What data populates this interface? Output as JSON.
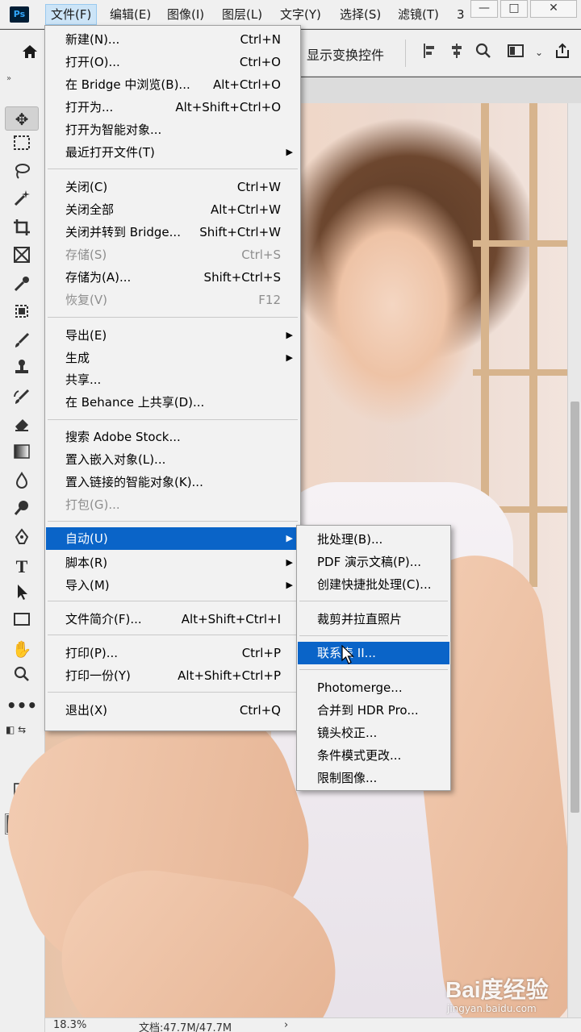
{
  "app": {
    "logo": "Ps",
    "menus": [
      "文件(F)",
      "编辑(E)",
      "图像(I)",
      "图层(L)",
      "文字(Y)",
      "选择(S)",
      "滤镜(T)",
      "3"
    ],
    "window_buttons": [
      "—",
      "□",
      "✕"
    ]
  },
  "options_bar": {
    "show_transform_label": "显示变换控件",
    "icons": [
      "home-icon",
      "align-left-icon",
      "align-center-icon",
      "search-icon",
      "workspace-icon",
      "chevron-down-icon",
      "share-icon"
    ]
  },
  "tools": [
    "move",
    "marquee",
    "lasso",
    "magic-wand",
    "crop",
    "frame",
    "eyedropper",
    "spot-heal",
    "brush",
    "stamp",
    "history-brush",
    "eraser",
    "gradient",
    "blur",
    "dodge",
    "pen",
    "type",
    "path-select",
    "rectangle",
    "hand",
    "zoom",
    "more"
  ],
  "file_menu": {
    "items": [
      {
        "label": "新建(N)...",
        "shortcut": "Ctrl+N"
      },
      {
        "label": "打开(O)...",
        "shortcut": "Ctrl+O"
      },
      {
        "label": "在 Bridge 中浏览(B)...",
        "shortcut": "Alt+Ctrl+O"
      },
      {
        "label": "打开为...",
        "shortcut": "Alt+Shift+Ctrl+O"
      },
      {
        "label": "打开为智能对象...",
        "shortcut": ""
      },
      {
        "label": "最近打开文件(T)",
        "shortcut": ""
      },
      {
        "label": "关闭(C)",
        "shortcut": "Ctrl+W"
      },
      {
        "label": "关闭全部",
        "shortcut": "Alt+Ctrl+W"
      },
      {
        "label": "关闭并转到 Bridge...",
        "shortcut": "Shift+Ctrl+W"
      },
      {
        "label": "存储(S)",
        "shortcut": "Ctrl+S"
      },
      {
        "label": "存储为(A)...",
        "shortcut": "Shift+Ctrl+S"
      },
      {
        "label": "恢复(V)",
        "shortcut": "F12"
      },
      {
        "label": "导出(E)",
        "shortcut": ""
      },
      {
        "label": "生成",
        "shortcut": ""
      },
      {
        "label": "共享...",
        "shortcut": ""
      },
      {
        "label": "在 Behance 上共享(D)...",
        "shortcut": ""
      },
      {
        "label": "搜索 Adobe Stock...",
        "shortcut": ""
      },
      {
        "label": "置入嵌入对象(L)...",
        "shortcut": ""
      },
      {
        "label": "置入链接的智能对象(K)...",
        "shortcut": ""
      },
      {
        "label": "打包(G)...",
        "shortcut": ""
      },
      {
        "label": "自动(U)",
        "shortcut": ""
      },
      {
        "label": "脚本(R)",
        "shortcut": ""
      },
      {
        "label": "导入(M)",
        "shortcut": ""
      },
      {
        "label": "文件简介(F)...",
        "shortcut": "Alt+Shift+Ctrl+I"
      },
      {
        "label": "打印(P)...",
        "shortcut": "Ctrl+P"
      },
      {
        "label": "打印一份(Y)",
        "shortcut": "Alt+Shift+Ctrl+P"
      },
      {
        "label": "退出(X)",
        "shortcut": "Ctrl+Q"
      }
    ],
    "disabled": [
      "存储(S)",
      "恢复(V)",
      "打包(G)..."
    ],
    "highlighted": "自动(U)"
  },
  "auto_submenu": {
    "items": [
      "批处理(B)...",
      "PDF 演示文稿(P)...",
      "创建快捷批处理(C)...",
      "裁剪并拉直照片",
      "联系表 II...",
      "Photomerge...",
      "合并到 HDR Pro...",
      "镜头校正...",
      "条件模式更改...",
      "限制图像..."
    ],
    "highlighted": "联系表 II..."
  },
  "status_bar": {
    "zoom": "18.3%",
    "doc_size": "文档:47.7M/47.7M",
    "arrow": "›"
  },
  "watermark": {
    "brand": "Bai度经验",
    "url": "jingyan.baidu.com"
  },
  "colors": {
    "menu_highlight": "#0a64c8",
    "menu_bg": "#f2f2f2",
    "ui_bg": "#efefef"
  }
}
